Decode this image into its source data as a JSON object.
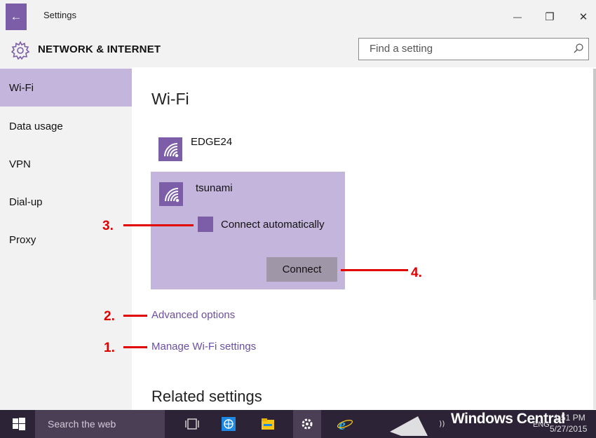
{
  "window": {
    "title": "Settings",
    "back_icon": "←",
    "minimize_icon": "—",
    "maximize_icon": "❐",
    "close_icon": "✕"
  },
  "header": {
    "section_title": "NETWORK & INTERNET",
    "search_placeholder": "Find a setting"
  },
  "sidebar": {
    "items": [
      {
        "label": "Wi-Fi",
        "selected": true
      },
      {
        "label": "Data usage",
        "selected": false
      },
      {
        "label": "VPN",
        "selected": false
      },
      {
        "label": "Dial-up",
        "selected": false
      },
      {
        "label": "Proxy",
        "selected": false
      }
    ]
  },
  "main": {
    "heading": "Wi-Fi",
    "networks": [
      {
        "name": "EDGE24",
        "icon": "wifi-icon"
      },
      {
        "name": "tsunami",
        "icon": "wifi-icon",
        "selected": true,
        "connect_automatically_label": "Connect automatically",
        "connect_automatically_checked": true,
        "connect_button_label": "Connect"
      }
    ],
    "advanced_options_link": "Advanced options",
    "manage_wifi_link": "Manage Wi-Fi settings",
    "related_heading": "Related settings"
  },
  "annotations": {
    "one": "1.",
    "two": "2.",
    "three": "3.",
    "four": "4."
  },
  "taskbar": {
    "search_text": "Search the web",
    "lang": "ENG",
    "time": "1:51 PM",
    "date": "5/27/2015",
    "watermark": "Windows Central"
  },
  "colors": {
    "accent": "#7b5ea7",
    "selection": "#c4b5dd",
    "annotation": "#e00000",
    "taskbar": "#2c2336"
  }
}
